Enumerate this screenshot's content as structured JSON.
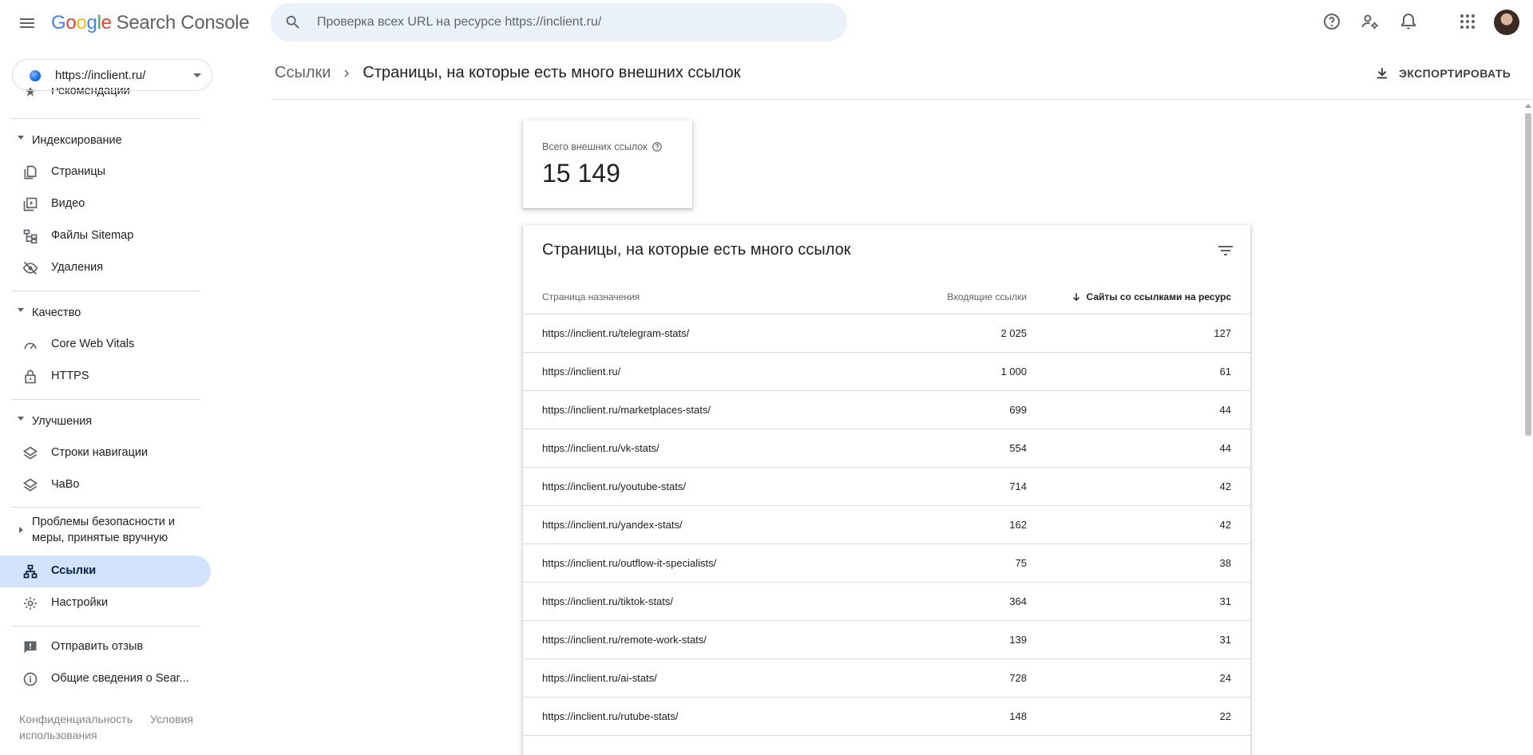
{
  "app": {
    "logo_google_letters": [
      "G",
      "o",
      "o",
      "g",
      "l",
      "e"
    ],
    "logo_product": "Search Console"
  },
  "search": {
    "placeholder": "Проверка всех URL на ресурсе https://inclient.ru/"
  },
  "property": {
    "url": "https://inclient.ru/"
  },
  "sidebar": {
    "partial_item": "Рекомендации",
    "sections": {
      "indexing": "Индексирование",
      "quality": "Качество",
      "enhancements": "Улучшения",
      "security": "Проблемы безопасности и меры, принятые вручную"
    },
    "items": {
      "pages": "Страницы",
      "video": "Видео",
      "sitemaps": "Файлы Sitemap",
      "removals": "Удаления",
      "cwv": "Core Web Vitals",
      "https": "HTTPS",
      "breadcrumbs": "Строки навигации",
      "faq": "ЧаВо",
      "links": "Ссылки",
      "settings": "Настройки",
      "feedback": "Отправить отзыв",
      "about": "Общие сведения о Sear..."
    },
    "footer": {
      "privacy": "Конфиденциальность",
      "terms": "Условия использования"
    }
  },
  "header": {
    "breadcrumb_parent": "Ссылки",
    "breadcrumb_current": "Страницы, на которые есть много внешних ссылок",
    "export_label": "ЭКСПОРТИРОВАТЬ"
  },
  "kpi": {
    "label": "Всего внешних ссылок",
    "value": "15 149"
  },
  "table": {
    "title": "Страницы, на которые есть много ссылок",
    "columns": [
      "Страница назначения",
      "Входящие ссылки",
      "Сайты со ссылками на ресурс"
    ],
    "rows": [
      [
        "https://inclient.ru/telegram-stats/",
        "2 025",
        "127"
      ],
      [
        "https://inclient.ru/",
        "1 000",
        "61"
      ],
      [
        "https://inclient.ru/marketplaces-stats/",
        "699",
        "44"
      ],
      [
        "https://inclient.ru/vk-stats/",
        "554",
        "44"
      ],
      [
        "https://inclient.ru/youtube-stats/",
        "714",
        "42"
      ],
      [
        "https://inclient.ru/yandex-stats/",
        "162",
        "42"
      ],
      [
        "https://inclient.ru/outflow-it-specialists/",
        "75",
        "38"
      ],
      [
        "https://inclient.ru/tiktok-stats/",
        "364",
        "31"
      ],
      [
        "https://inclient.ru/remote-work-stats/",
        "139",
        "31"
      ],
      [
        "https://inclient.ru/ai-stats/",
        "728",
        "24"
      ],
      [
        "https://inclient.ru/rutube-stats/",
        "148",
        "22"
      ]
    ]
  },
  "colors": {
    "accent": "#1a73e8",
    "active_nav": "#d3e3fd",
    "search_bg": "#eaf1fb"
  }
}
